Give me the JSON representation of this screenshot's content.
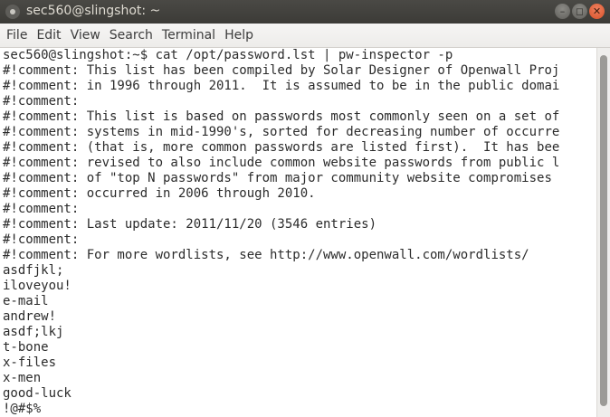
{
  "window": {
    "title": "sec560@slingshot: ~",
    "buttons": {
      "minimize": "–",
      "maximize": "◻",
      "close": "✕"
    }
  },
  "menubar": {
    "items": [
      "File",
      "Edit",
      "View",
      "Search",
      "Terminal",
      "Help"
    ]
  },
  "terminal": {
    "lines": [
      "sec560@slingshot:~$ cat /opt/password.lst | pw-inspector -p",
      "#!comment: This list has been compiled by Solar Designer of Openwall Proj",
      "#!comment: in 1996 through 2011.  It is assumed to be in the public domai",
      "#!comment:",
      "#!comment: This list is based on passwords most commonly seen on a set of",
      "#!comment: systems in mid-1990's, sorted for decreasing number of occurre",
      "#!comment: (that is, more common passwords are listed first).  It has bee",
      "#!comment: revised to also include common website passwords from public l",
      "#!comment: of \"top N passwords\" from major community website compromises",
      "#!comment: occurred in 2006 through 2010.",
      "#!comment:",
      "#!comment: Last update: 2011/11/20 (3546 entries)",
      "#!comment:",
      "#!comment: For more wordlists, see http://www.openwall.com/wordlists/",
      "asdfjkl;",
      "iloveyou!",
      "e-mail",
      "andrew!",
      "asdf;lkj",
      "t-bone",
      "x-files",
      "x-men",
      "good-luck",
      "!@#$%"
    ]
  }
}
